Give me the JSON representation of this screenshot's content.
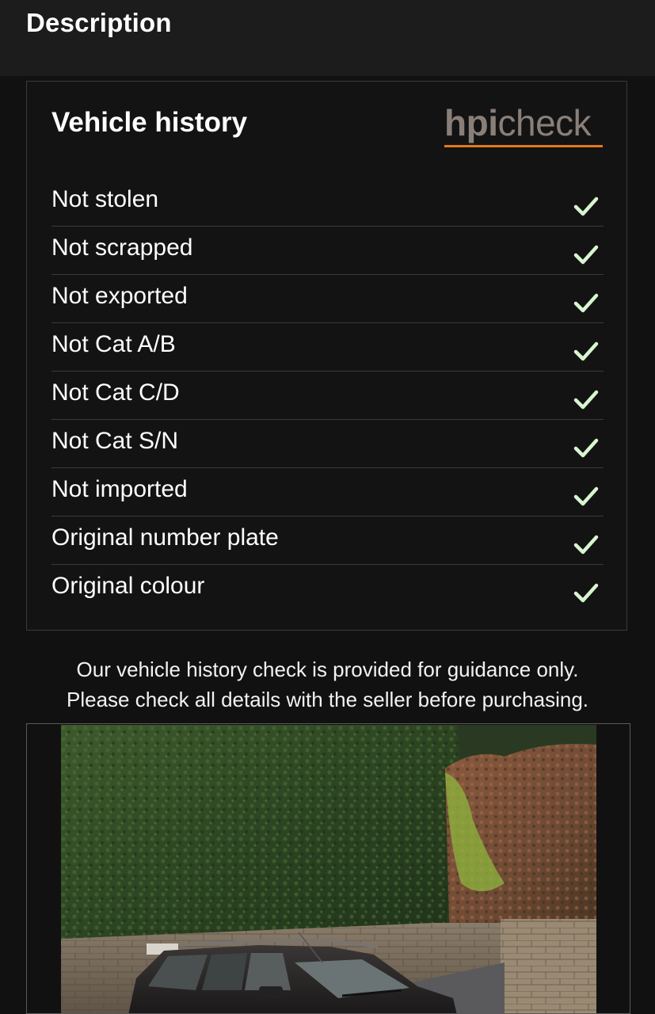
{
  "header": {
    "title": "Description"
  },
  "vehicle_history": {
    "title": "Vehicle history",
    "provider_logo": {
      "text_bold": "hpi",
      "text_light": "check",
      "accent_color": "#e07a1a"
    },
    "checks": [
      {
        "label": "Not stolen",
        "status": "check-icon"
      },
      {
        "label": "Not scrapped",
        "status": "check-icon"
      },
      {
        "label": "Not exported",
        "status": "check-icon"
      },
      {
        "label": "Not Cat A/B",
        "status": "check-icon"
      },
      {
        "label": "Not Cat C/D",
        "status": "check-icon"
      },
      {
        "label": "Not Cat S/N",
        "status": "check-icon"
      },
      {
        "label": "Not imported",
        "status": "check-icon"
      },
      {
        "label": "Original number plate",
        "status": "check-icon"
      },
      {
        "label": "Original colour",
        "status": "check-icon"
      }
    ],
    "check_color": "#d8f5d0"
  },
  "disclaimer": {
    "line1": "Our vehicle history check is provided for guidance only.",
    "line2": "Please check all details with the seller before purchasing."
  },
  "photo": {
    "subject": "car-photo"
  }
}
